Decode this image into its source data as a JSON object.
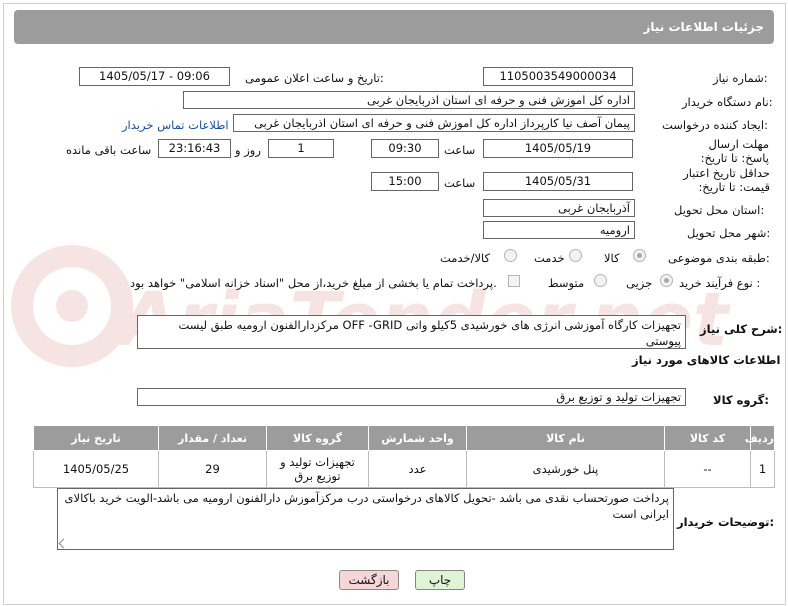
{
  "header": {
    "title": "جزئیات اطلاعات نیاز"
  },
  "watermark": {
    "text": "AriaTender.net"
  },
  "fields": {
    "need_number_label": "شماره نیاز:",
    "need_number": "1105003549000034",
    "announce_label": "تاریخ و ساعت اعلان عمومی:",
    "announce_value": "1405/05/17 - 09:06",
    "buyer_label": "نام دستگاه خریدار:",
    "buyer_value": "اداره کل اموزش فنی و حرفه ای استان اذربایجان غربی",
    "creator_label": "ایجاد کننده درخواست:",
    "creator_value": "پیمان آصف نیا کارپرداز اداره کل اموزش فنی و حرفه ای استان اذربایجان غربی",
    "contact_link": "اطلاعات تماس خریدار",
    "deadline_label": "مهلت ارسال پاسخ: تا تاریخ:",
    "deadline_date": "1405/05/19",
    "time_label": "ساعت",
    "deadline_time": "09:30",
    "days_value": "1",
    "days_label": "روز و",
    "remaining_time": "23:16:43",
    "remaining_label": "ساعت باقی مانده",
    "price_label": "حداقل تاریخ اعتبار قیمت: تا تاریخ:",
    "price_date": "1405/05/31",
    "price_time": "15:00",
    "province_label": "استان محل تحویل:",
    "province_value": "آذربایجان غربی",
    "city_label": "شهر محل تحویل:",
    "city_value": "ارومیه",
    "category_label": "طبقه بندی موضوعی:",
    "cat_goods": "کالا",
    "cat_service": "خدمت",
    "cat_goods_service": "کالا/خدمت",
    "process_label": "نوع فرآیند خرید :",
    "proc_partial": "جزیی",
    "proc_medium": "متوسط",
    "payment_note": "پرداخت تمام یا بخشی از مبلغ خرید،از محل \"اسناد خزانه اسلامی\" خواهد بود.",
    "desc_label": "شرح کلی نیاز:",
    "desc_value": "تجهیزات کارگاه آموزشی انرژی های خورشیدی 5کیلو واتی OFF -GRID مرکزدارالفنون ارومیه طبق لیست پیوستی",
    "goods_info_title": "اطلاعات کالاهای مورد نیاز",
    "group_label": "گروه کالا:",
    "group_value": "تجهیزات تولید و توزیع برق",
    "buyer_notes_label": "توضیحات خریدار:",
    "buyer_notes_value": "پرداخت صورتحساب نقدی می باشد -تحویل کالاهای درخواستی درب مرکزآموزش دارالفنون ارومیه می باشد-الویت خرید باکالای ایرانی است"
  },
  "table": {
    "headers": [
      "ردیف",
      "کد کالا",
      "نام کالا",
      "واحد شمارش",
      "گروه کالا",
      "تعداد / مقدار",
      "تاریخ نیاز"
    ],
    "rows": [
      [
        "1",
        "--",
        "پنل خورشیدی",
        "عدد",
        "تجهیزات تولید و توزیع برق",
        "29",
        "1405/05/25"
      ]
    ]
  },
  "buttons": {
    "print": "چاپ",
    "back": "بازگشت"
  },
  "colors": {
    "header_bg": "#9c9c9c",
    "back_button_bg": "#f6d6d6",
    "print_button_bg": "#dff3d6",
    "link": "#1a4fa0"
  }
}
